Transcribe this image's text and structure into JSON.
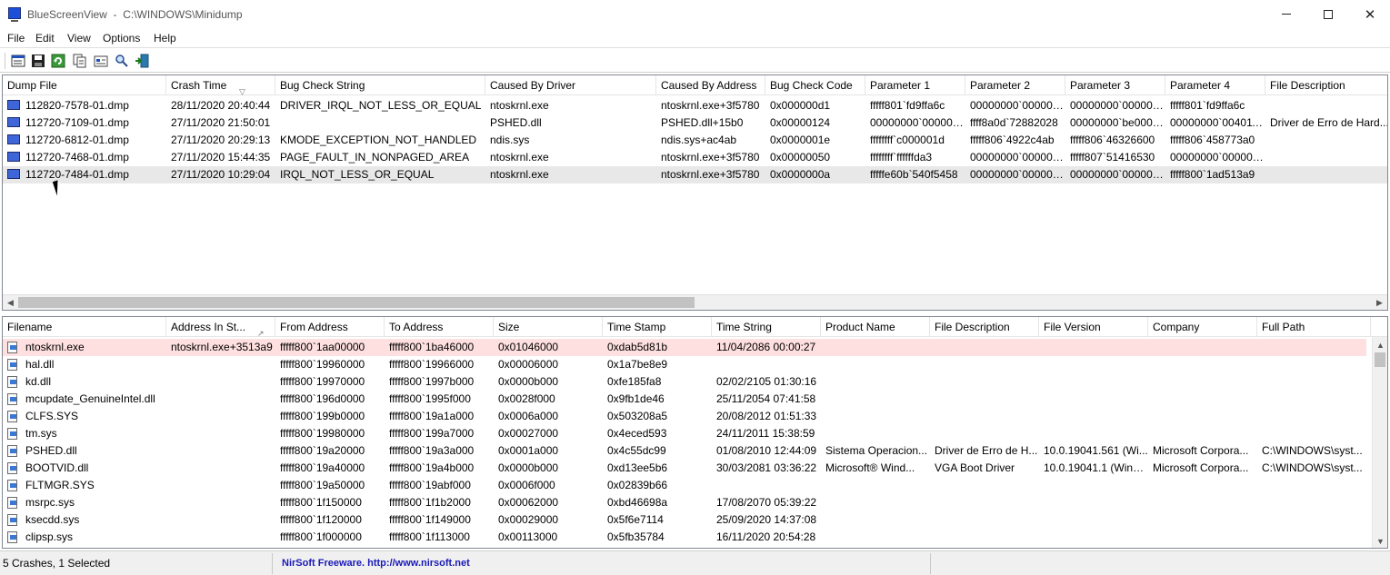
{
  "window": {
    "app_name": "BlueScreenView",
    "path": "C:\\WINDOWS\\Minidump",
    "close_glyph": "✕"
  },
  "menu": [
    "File",
    "Edit",
    "View",
    "Options",
    "Help"
  ],
  "toolbar": [
    "properties-icon",
    "save-icon",
    "refresh-icon",
    "copy-icon",
    "options-icon",
    "find-icon",
    "exit-icon"
  ],
  "upper": {
    "columns": [
      "Dump File",
      "Crash Time",
      "Bug Check String",
      "Caused By Driver",
      "Caused By Address",
      "Bug Check Code",
      "Parameter 1",
      "Parameter 2",
      "Parameter 3",
      "Parameter 4",
      "File Description"
    ],
    "rows": [
      [
        "112820-7578-01.dmp",
        "28/11/2020 20:40:44",
        "DRIVER_IRQL_NOT_LESS_OR_EQUAL",
        "ntoskrnl.exe",
        "ntoskrnl.exe+3f5780",
        "0x000000d1",
        "fffff801`fd9ffa6c",
        "00000000`000000...",
        "00000000`000000...",
        "fffff801`fd9ffa6c",
        ""
      ],
      [
        "112720-7109-01.dmp",
        "27/11/2020 21:50:01",
        "",
        "PSHED.dll",
        "PSHED.dll+15b0",
        "0x00000124",
        "00000000`000000...",
        "ffff8a0d`72882028",
        "00000000`be0000...",
        "00000000`004011...",
        "Driver de Erro de Hard..."
      ],
      [
        "112720-6812-01.dmp",
        "27/11/2020 20:29:13",
        "KMODE_EXCEPTION_NOT_HANDLED",
        "ndis.sys",
        "ndis.sys+ac4ab",
        "0x0000001e",
        "ffffffff`c000001d",
        "fffff806`4922c4ab",
        "fffff806`46326600",
        "fffff806`458773a0",
        ""
      ],
      [
        "112720-7468-01.dmp",
        "27/11/2020 15:44:35",
        "PAGE_FAULT_IN_NONPAGED_AREA",
        "ntoskrnl.exe",
        "ntoskrnl.exe+3f5780",
        "0x00000050",
        "ffffffff`ffffffda3",
        "00000000`000000...",
        "fffff807`51416530",
        "00000000`000000...",
        ""
      ],
      [
        "112720-7484-01.dmp",
        "27/11/2020 10:29:04",
        "IRQL_NOT_LESS_OR_EQUAL",
        "ntoskrnl.exe",
        "ntoskrnl.exe+3f5780",
        "0x0000000a",
        "fffffe60b`540f5458",
        "00000000`000000...",
        "00000000`000000...",
        "fffff800`1ad513a9",
        ""
      ]
    ]
  },
  "lower": {
    "columns": [
      "Filename",
      "Address In St...",
      "From Address",
      "To Address",
      "Size",
      "Time Stamp",
      "Time String",
      "Product Name",
      "File Description",
      "File Version",
      "Company",
      "Full Path"
    ],
    "rows": [
      [
        "ntoskrnl.exe",
        "ntoskrnl.exe+3513a9",
        "fffff800`1aa00000",
        "fffff800`1ba46000",
        "0x01046000",
        "0xdab5d81b",
        "11/04/2086 00:00:27",
        "",
        "",
        "",
        "",
        ""
      ],
      [
        "hal.dll",
        "",
        "fffff800`19960000",
        "fffff800`19966000",
        "0x00006000",
        "0x1a7be8e9",
        "",
        "",
        "",
        "",
        "",
        ""
      ],
      [
        "kd.dll",
        "",
        "fffff800`19970000",
        "fffff800`1997b000",
        "0x0000b000",
        "0xfe185fa8",
        "02/02/2105 01:30:16",
        "",
        "",
        "",
        "",
        ""
      ],
      [
        "mcupdate_GenuineIntel.dll",
        "",
        "fffff800`196d0000",
        "fffff800`1995f000",
        "0x0028f000",
        "0x9fb1de46",
        "25/11/2054 07:41:58",
        "",
        "",
        "",
        "",
        ""
      ],
      [
        "CLFS.SYS",
        "",
        "fffff800`199b0000",
        "fffff800`19a1a000",
        "0x0006a000",
        "0x503208a5",
        "20/08/2012 01:51:33",
        "",
        "",
        "",
        "",
        ""
      ],
      [
        "tm.sys",
        "",
        "fffff800`19980000",
        "fffff800`199a7000",
        "0x00027000",
        "0x4eced593",
        "24/11/2011 15:38:59",
        "",
        "",
        "",
        "",
        ""
      ],
      [
        "PSHED.dll",
        "",
        "fffff800`19a20000",
        "fffff800`19a3a000",
        "0x0001a000",
        "0x4c55dc99",
        "01/08/2010 12:44:09",
        "Sistema Operacion...",
        "Driver de Erro de H...",
        "10.0.19041.561 (Wi...",
        "Microsoft Corpora...",
        "C:\\WINDOWS\\syst..."
      ],
      [
        "BOOTVID.dll",
        "",
        "fffff800`19a40000",
        "fffff800`19a4b000",
        "0x0000b000",
        "0xd13ee5b6",
        "30/03/2081 03:36:22",
        "Microsoft® Wind...",
        "VGA Boot Driver",
        "10.0.19041.1 (WinB...",
        "Microsoft Corpora...",
        "C:\\WINDOWS\\syst..."
      ],
      [
        "FLTMGR.SYS",
        "",
        "fffff800`19a50000",
        "fffff800`19abf000",
        "0x0006f000",
        "0x02839b66",
        "",
        "",
        "",
        "",
        "",
        ""
      ],
      [
        "msrpc.sys",
        "",
        "fffff800`1f150000",
        "fffff800`1f1b2000",
        "0x00062000",
        "0xbd46698a",
        "17/08/2070 05:39:22",
        "",
        "",
        "",
        "",
        ""
      ],
      [
        "ksecdd.sys",
        "",
        "fffff800`1f120000",
        "fffff800`1f149000",
        "0x00029000",
        "0x5f6e7114",
        "25/09/2020 14:37:08",
        "",
        "",
        "",
        "",
        ""
      ],
      [
        "clipsp.sys",
        "",
        "fffff800`1f000000",
        "fffff800`1f113000",
        "0x00113000",
        "0x5fb35784",
        "16/11/2020 20:54:28",
        "",
        "",
        "",
        "",
        ""
      ]
    ]
  },
  "status": {
    "crashes": "5 Crashes, 1 Selected",
    "credit": "NirSoft Freeware.  http://www.nirsoft.net"
  },
  "colors": {
    "selected_row": "#e8e8e8",
    "highlight_row": "#ffe0e0",
    "link_text": "#1a1ab8"
  }
}
